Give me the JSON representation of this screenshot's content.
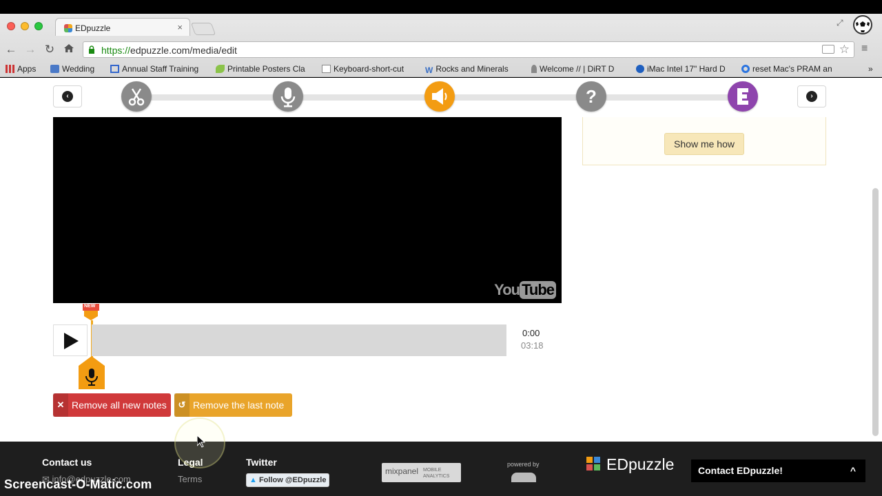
{
  "browser": {
    "tab_title": "EDpuzzle",
    "tab_close": "×",
    "url_scheme": "https://",
    "url_rest": "edpuzzle.com/media/edit",
    "bookmarks": [
      {
        "label": "Apps",
        "icon": "apps-grid-icon"
      },
      {
        "label": "Wedding",
        "icon": "folder-icon"
      },
      {
        "label": "Annual Staff Training",
        "icon": "doc-icon"
      },
      {
        "label": "Printable Posters Cla",
        "icon": "leaf-icon"
      },
      {
        "label": "Keyboard-short-cut",
        "icon": "page-icon"
      },
      {
        "label": "Rocks and Minerals",
        "icon": "w-icon"
      },
      {
        "label": "Welcome // | DiRT D",
        "icon": "pin-icon"
      },
      {
        "label": "iMac Intel 17\" Hard D",
        "icon": "x-circle-icon"
      },
      {
        "label": "reset Mac's PRAM an",
        "icon": "circle-icon"
      }
    ],
    "more_bookmarks": "»"
  },
  "editor": {
    "steps": [
      "cut",
      "voiceover",
      "audio-notes",
      "quiz",
      "finish"
    ],
    "active_step": "audio-notes",
    "show_me_how": "Show me how",
    "youtube_you": "You",
    "youtube_tube": "Tube",
    "time_current": "0:00",
    "time_total": "03:18",
    "new_badge": "NEW",
    "remove_all": "Remove all new notes",
    "remove_last": "Remove the last note"
  },
  "colors": {
    "red_button": "#d0393a",
    "orange_button": "#e9a42a",
    "active_step": "#f39c12",
    "finish_step": "#8e44ad",
    "inactive_step": "#8a8a8a"
  },
  "footer": {
    "contact_heading": "Contact us",
    "contact_email": "info@edpuzzle.com",
    "legal_heading": "Legal",
    "legal_terms": "Terms",
    "twitter_heading": "Twitter",
    "twitter_follow": "Follow @EDpuzzle",
    "mixpanel": "mixpanel",
    "mixpanel_sub": "MOBILE ANALYTICS",
    "powered_by": "powered by",
    "brand": "EDpuzzle",
    "contact_widget": "Contact EDpuzzle!",
    "contact_widget_arrow": "^"
  },
  "watermark": "Screencast-O-Matic.com"
}
